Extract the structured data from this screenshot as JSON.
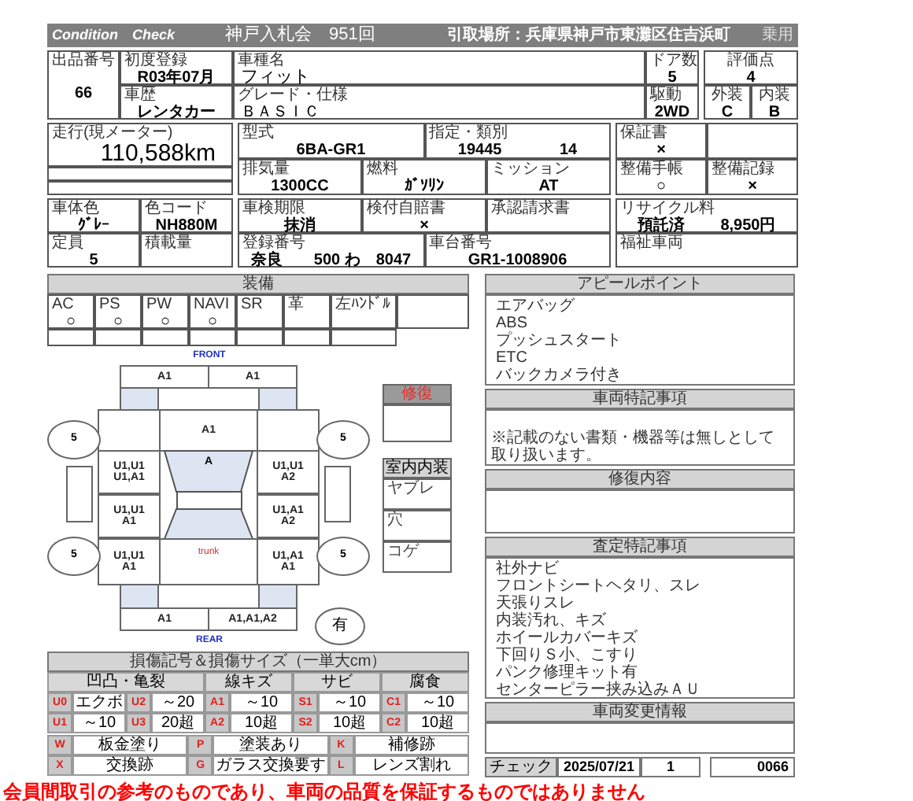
{
  "header": {
    "title": "Condition　Check",
    "auction": "神戸入札会　951回",
    "pickup": "引取場所：兵庫県神戸市東灘区住吉浜町",
    "category": "乗用"
  },
  "block1": {
    "lot": {
      "label": "出品番号",
      "value": "66"
    },
    "first_reg": {
      "label": "初度登録",
      "value": "R03年07月"
    },
    "car_name": {
      "label": "車種名",
      "value": "フィット"
    },
    "doors": {
      "label": "ドア数",
      "value": "5"
    },
    "history": {
      "label": "車歴",
      "value": "レンタカー"
    },
    "grade": {
      "label": "グレード・仕様",
      "value": "ＢＡＳＩＣ"
    },
    "drive": {
      "label": "駆動",
      "value": "2WD"
    },
    "score": {
      "label": "評価点",
      "value": "4"
    },
    "exterior": {
      "label": "外装",
      "value": "C"
    },
    "interior": {
      "label": "内装",
      "value": "B"
    }
  },
  "block2": {
    "mileage": {
      "label": "走行(現メーター)",
      "value": "110,588km"
    },
    "model": {
      "label": "型式",
      "value": "6BA-GR1"
    },
    "designation": {
      "label": "指定・類別",
      "values": [
        "19445",
        "14"
      ]
    },
    "displacement": {
      "label": "排気量",
      "value": "1300CC"
    },
    "fuel": {
      "label": "燃料",
      "value": "ｶﾞｿﾘﾝ"
    },
    "transmission": {
      "label": "ミッション",
      "value": "AT"
    },
    "warranty": {
      "label": "保証書",
      "value": "×"
    },
    "manual": {
      "label": "整備手帳",
      "value": "○"
    },
    "record": {
      "label": "整備記録",
      "value": "×"
    }
  },
  "block3": {
    "color": {
      "label": "車体色",
      "value": "ｸﾞﾚｰ"
    },
    "color_code": {
      "label": "色コード",
      "value": "NH880M"
    },
    "capacity": {
      "label": "定員",
      "value": "5"
    },
    "load": {
      "label": "積載量"
    },
    "inspection": {
      "label": "車検期限",
      "value": "抹消"
    },
    "insurance": {
      "label": "検付自賠書",
      "value": "×"
    },
    "approval": {
      "label": "承認請求書"
    },
    "plate": {
      "label": "登録番号",
      "value": "奈良　　500 わ　8047"
    },
    "chassis": {
      "label": "車台番号",
      "value": "GR1-1008906"
    },
    "recycle": {
      "label": "リサイクル料",
      "values": [
        "預託済",
        "8,950円"
      ]
    },
    "welfare": {
      "label": "福祉車両"
    }
  },
  "equipment": {
    "title": "装備",
    "items": [
      {
        "label": "AC",
        "value": "○"
      },
      {
        "label": "PS",
        "value": "○"
      },
      {
        "label": "PW",
        "value": "○"
      },
      {
        "label": "NAVI",
        "value": "○"
      },
      {
        "label": "SR"
      },
      {
        "label": "革"
      },
      {
        "label": "左ﾊﾝﾄﾞﾙ"
      }
    ]
  },
  "diagram": {
    "front_label": "FRONT",
    "rear_label": "REAR",
    "front_bumper": [
      "A1",
      "A1"
    ],
    "hood": "A1",
    "windshield": "A",
    "trunk": "trunk",
    "left": [
      [
        "U1,U1",
        "U1,A1"
      ],
      [
        "U1,U1",
        "A1"
      ],
      [
        "U1,U1",
        "A1"
      ]
    ],
    "right": [
      [
        "U1,U1",
        "A2"
      ],
      [
        "U1,A1",
        "A2"
      ],
      [
        "U1,A1",
        "A1"
      ]
    ],
    "rear_bumper": [
      "A1",
      "A1,A1,A2"
    ],
    "tires": [
      "5",
      "5",
      "5",
      "5"
    ],
    "spare": "有"
  },
  "repair_box": {
    "title": "修復"
  },
  "interior_box": {
    "title": "室内内装",
    "items": [
      "ヤブレ",
      "穴",
      "コゲ"
    ]
  },
  "legend": {
    "title": "損傷記号＆損傷サイズ（一単大cm）",
    "groups": [
      "凹凸・亀裂",
      "線キズ",
      "サビ",
      "腐食"
    ],
    "rows": [
      [
        {
          "code": "U0",
          "text": "エクボ"
        },
        {
          "code": "U2",
          "text": "～20"
        },
        {
          "code": "A1",
          "text": "～10"
        },
        {
          "code": "S1",
          "text": "～10"
        },
        {
          "code": "C1",
          "text": "～10"
        }
      ],
      [
        {
          "code": "U1",
          "text": "～10"
        },
        {
          "code": "U3",
          "text": "20超"
        },
        {
          "code": "A2",
          "text": "10超"
        },
        {
          "code": "S2",
          "text": "10超"
        },
        {
          "code": "C2",
          "text": "10超"
        }
      ]
    ],
    "marks": [
      [
        {
          "code": "W",
          "text": "板金塗り"
        },
        {
          "code": "P",
          "text": "塗装あり"
        },
        {
          "code": "K",
          "text": "補修跡"
        }
      ],
      [
        {
          "code": "X",
          "text": "交換跡"
        },
        {
          "code": "G",
          "text": "ガラス交換要す"
        },
        {
          "code": "L",
          "text": "レンズ割れ"
        }
      ]
    ]
  },
  "appeal": {
    "title": "アピールポイント",
    "lines": [
      "エアバッグ",
      "ABS",
      "プッシュスタート",
      "ETC",
      "バックカメラ付き"
    ]
  },
  "vehicle_notes": {
    "title": "車両特記事項",
    "note": "※記載のない書類・機器等は無しとして取り扱います。"
  },
  "repair": {
    "title": "修復内容"
  },
  "inspector": {
    "title": "査定特記事項",
    "lines": [
      "社外ナビ",
      "フロントシートヘタリ、スレ",
      "天張りスレ",
      "内装汚れ、キズ",
      "ホイールカバーキズ",
      "下回りＳ小、こすり",
      "パンク修理キット有",
      "センターピラー挟み込みＡＵ"
    ]
  },
  "change_info": {
    "title": "車両変更情報"
  },
  "check": {
    "label": "チェック",
    "date": "2025/07/21",
    "count": "1",
    "number": "0066"
  },
  "disclaimer": "会員間取引の参考のものであり、車両の品質を保証するものではありません"
}
